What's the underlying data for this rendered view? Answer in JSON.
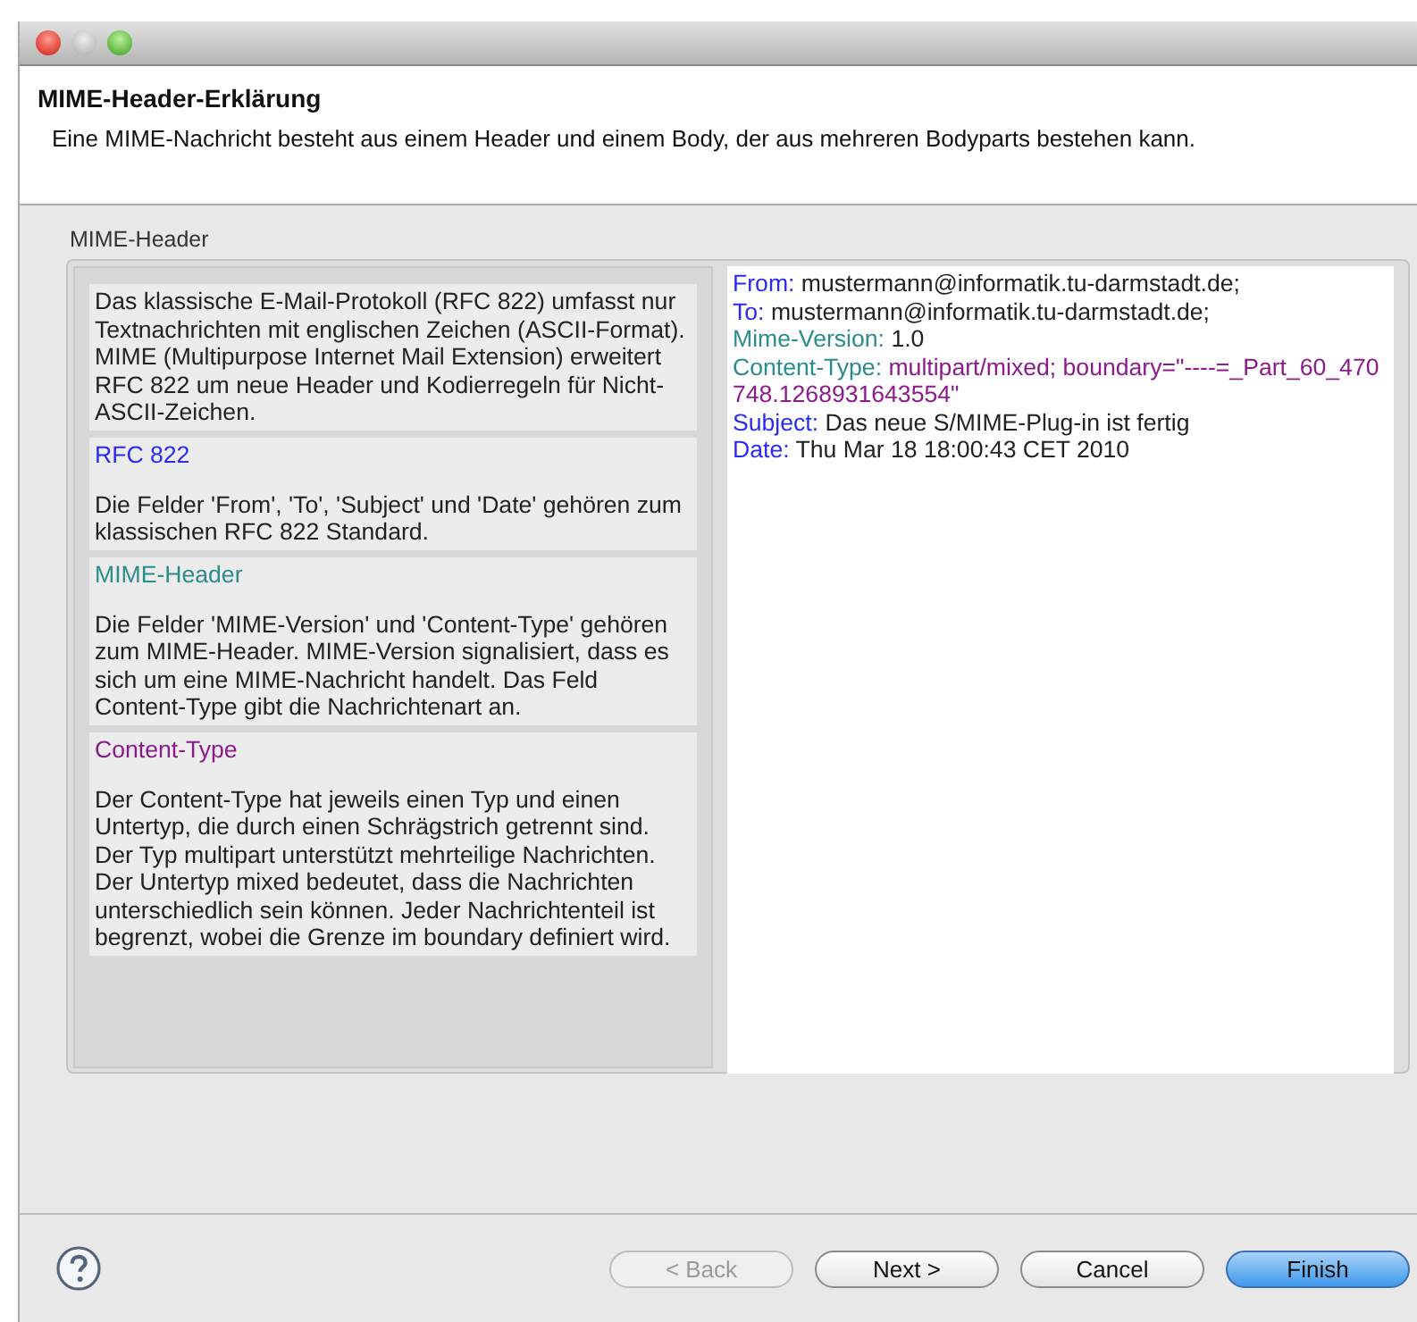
{
  "header": {
    "title": "MIME-Header-Erklärung",
    "description": "Eine MIME-Nachricht besteht aus einem Header und einem Body, der aus mehreren Bodyparts bestehen kann."
  },
  "group": {
    "label": "MIME-Header"
  },
  "sections": [
    {
      "body": "Das klassische E-Mail-Protokoll (RFC 822) umfasst nur Textnachrichten mit englischen Zeichen (ASCII-Format). MIME (Multipurpose Internet Mail Extension) erweitert RFC 822 um neue Header und Kodierregeln für Nicht-ASCII-Zeichen."
    },
    {
      "title": "RFC 822",
      "color": "#2a2af0",
      "body": "Die Felder 'From', 'To', 'Subject' und 'Date' gehören zum klassischen RFC 822 Standard."
    },
    {
      "title": "MIME-Header",
      "color": "#2a8c8c",
      "body": "Die Felder 'MIME-Version' und 'Content-Type' gehören zum MIME-Header. MIME-Version signalisiert, dass es sich um eine MIME-Nachricht handelt. Das Feld Content-Type gibt die Nachrichtenart an."
    },
    {
      "title": "Content-Type",
      "color": "#8c1a8c",
      "body": "Der Content-Type hat jeweils einen Typ und einen Untertyp, die durch einen Schrägstrich getrennt sind. Der Typ multipart unterstützt mehrteilige Nachrichten. Der Untertyp mixed bedeutet, dass die Nachrichten unterschiedlich sein können. Jeder Nachrichtenteil ist begrenzt, wobei die Grenze im boundary definiert wird."
    }
  ],
  "headers": [
    {
      "key": "From:",
      "color": "#2a2af0",
      "value": "mustermann@informatik.tu-darmstadt.de;",
      "highlighted": false
    },
    {
      "key": "To:",
      "color": "#2a2af0",
      "value": "mustermann@informatik.tu-darmstadt.de;",
      "highlighted": false
    },
    {
      "key": "Mime-Version:",
      "color": "#2a8c8c",
      "value": "1.0",
      "highlighted": false
    },
    {
      "key": "Content-Type:",
      "color": "#2a8c8c",
      "value": "multipart/mixed; boundary=\"----=_Part_60_470748.1268931643554\"",
      "highlighted": true
    },
    {
      "key": "Subject:",
      "color": "#2a2af0",
      "value": "Das neue S/MIME-Plug-in ist fertig",
      "highlighted": false
    },
    {
      "key": "Date:",
      "color": "#2a2af0",
      "value": "Thu Mar 18 18:00:43 CET 2010",
      "highlighted": false
    }
  ],
  "buttons": [
    {
      "label": "< Back",
      "disabled": true,
      "default": false
    },
    {
      "label": "Next >",
      "disabled": false,
      "default": false
    },
    {
      "label": "Cancel",
      "disabled": false,
      "default": false
    },
    {
      "label": "Finish",
      "disabled": false,
      "default": true
    }
  ]
}
